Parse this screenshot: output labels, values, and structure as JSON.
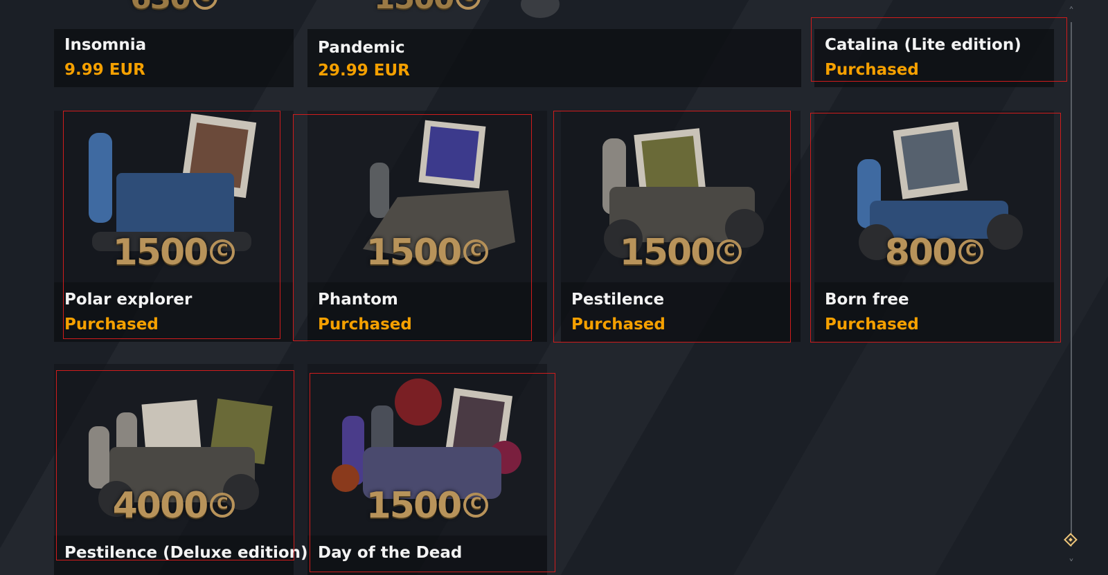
{
  "cards": [
    {
      "id": "insomnia",
      "title": "Insomnia",
      "status": "9.99 EUR",
      "price": "",
      "coin_icon": "coin-icon"
    },
    {
      "id": "pandemic",
      "title": "Pandemic",
      "status": "29.99 EUR",
      "price": "",
      "coin_icon": "coin-icon"
    },
    {
      "id": "catalina",
      "title": "Catalina (Lite edition)",
      "status": "Purchased",
      "price": "",
      "coin_icon": "coin-icon"
    },
    {
      "id": "polar",
      "title": "Polar explorer",
      "status": "Purchased",
      "price": "1500",
      "coin_icon": "coin-icon"
    },
    {
      "id": "phantom",
      "title": "Phantom",
      "status": "Purchased",
      "price": "1500",
      "coin_icon": "coin-icon"
    },
    {
      "id": "pestilence",
      "title": "Pestilence",
      "status": "Purchased",
      "price": "1500",
      "coin_icon": "coin-icon"
    },
    {
      "id": "bornfree",
      "title": "Born free",
      "status": "Purchased",
      "price": "800",
      "coin_icon": "coin-icon"
    },
    {
      "id": "pestilence_deluxe",
      "title": "Pestilence (Deluxe edition)",
      "status": "",
      "price": "4000",
      "coin_icon": "coin-icon"
    },
    {
      "id": "dayofdead",
      "title": "Day of the Dead",
      "status": "",
      "price": "1500",
      "coin_icon": "coin-icon"
    }
  ],
  "coin_symbol": "C",
  "colors": {
    "status": "#f5a000",
    "title": "#f3f3f3",
    "highlight": "#d11c1c",
    "gold": "#b8935a"
  },
  "scrollbar": {
    "up_icon": "chevron-up-icon",
    "down_icon": "chevron-down-icon",
    "thumb_icon": "diamond-thumb-icon"
  }
}
